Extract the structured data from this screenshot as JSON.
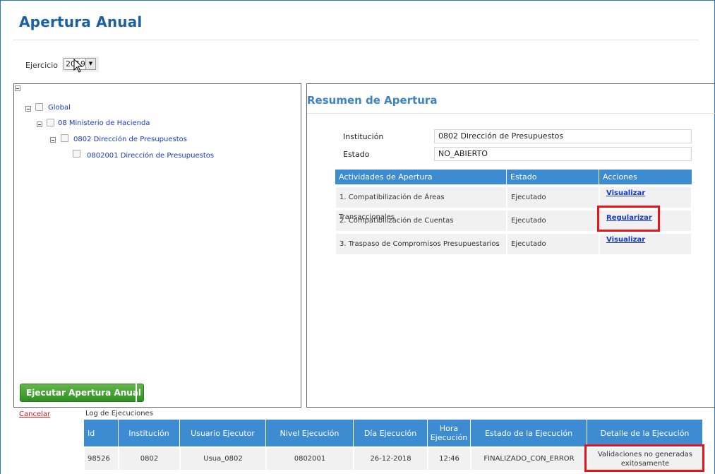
{
  "page": {
    "title": "Apertura Anual"
  },
  "ejercicio": {
    "label": "Ejercicio",
    "value": "2019"
  },
  "tree": {
    "root_toggle": "−",
    "nodes": [
      {
        "label": "Global"
      },
      {
        "label": "08 Ministerio de Hacienda"
      },
      {
        "label": "0802 Dirección de Presupuestos"
      },
      {
        "label": "0802001 Dirección de Presupuestos"
      }
    ]
  },
  "run_button": {
    "label": "Ejecutar Apertura Anual"
  },
  "resumen": {
    "title": "Resumen de Apertura",
    "institucion_label": "Institución",
    "institucion_value": "0802 Dirección de Presupuestos",
    "estado_label": "Estado",
    "estado_value": "NO_ABIERTO"
  },
  "actividades": {
    "headers": [
      "Actividades de Apertura",
      "Estado",
      "Acciones"
    ],
    "rows": [
      {
        "actividad": "1. Compatibilización de Áreas",
        "estado": "Ejecutado",
        "accion": "Visualizar"
      },
      {
        "actividad": "2. Compatibilización de Cuentas",
        "overlap": "Transaccionales",
        "estado": "Ejecutado",
        "accion": "Regularizar"
      },
      {
        "actividad": "3. Traspaso de Compromisos Presupuestarios",
        "estado": "Ejecutado",
        "accion": "Visualizar"
      }
    ]
  },
  "cancel": {
    "label": "Cancelar"
  },
  "log": {
    "title": "Log de Ejecuciones",
    "headers": [
      "Id",
      "Institución",
      "Usuario Ejecutor",
      "Nivel Ejecución",
      "Día Ejecución",
      "Hora Ejecución",
      "Estado de la Ejecución",
      "Detalle de la Ejecución"
    ],
    "rows": [
      [
        "98526",
        "0802",
        "Usua_0802",
        "0802001",
        "26-12-2018",
        "12:46",
        "FINALIZADO_CON_ERROR",
        "Validaciones no generadas exitosamente"
      ]
    ]
  },
  "colors": {
    "accent": "#3d8bd0",
    "title": "#1b5fa7",
    "highlight": "#e8141a",
    "button": "#2f8f22",
    "link": "#1538c8"
  }
}
